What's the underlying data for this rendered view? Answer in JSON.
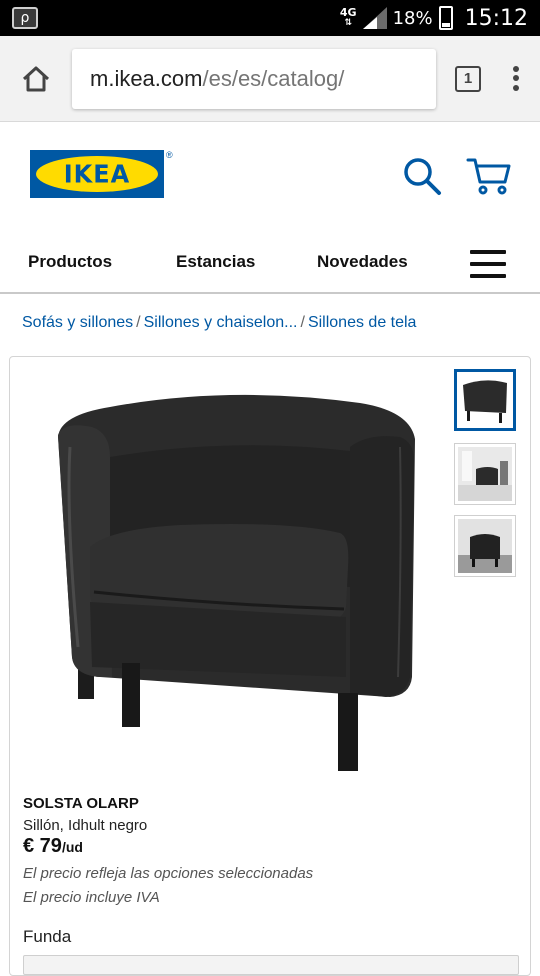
{
  "status_bar": {
    "network": "4G",
    "battery_percent": "18%",
    "battery_level": 0.18,
    "time": "15:12"
  },
  "browser": {
    "url_host": "m.ikea.com",
    "url_path": "/es/es/catalog/",
    "tab_count": "1"
  },
  "header": {
    "logo_text": "IKEA",
    "logo_mark": "®",
    "brand_blue": "#0058a3",
    "brand_yellow": "#ffdb00"
  },
  "nav": {
    "items": [
      {
        "label": "Productos"
      },
      {
        "label": "Estancias"
      },
      {
        "label": "Novedades"
      }
    ]
  },
  "breadcrumb": [
    {
      "label": "Sofás y sillones"
    },
    {
      "label": "Sillones y chaiselon..."
    },
    {
      "label": "Sillones de tela"
    }
  ],
  "product": {
    "name": "SOLSTA OLARP",
    "description": "Sillón, Idhult negro",
    "price": "€ 79",
    "price_unit": "/ud",
    "price_note_1": "El precio refleja las opciones seleccionadas",
    "price_note_2": "El precio incluye IVA",
    "option_label": "Funda"
  },
  "icons": {
    "home": "home-icon",
    "tabs": "tabs-icon",
    "menu": "overflow-menu-icon",
    "search": "search-icon",
    "cart": "cart-icon",
    "hamburger": "hamburger-menu-icon"
  }
}
